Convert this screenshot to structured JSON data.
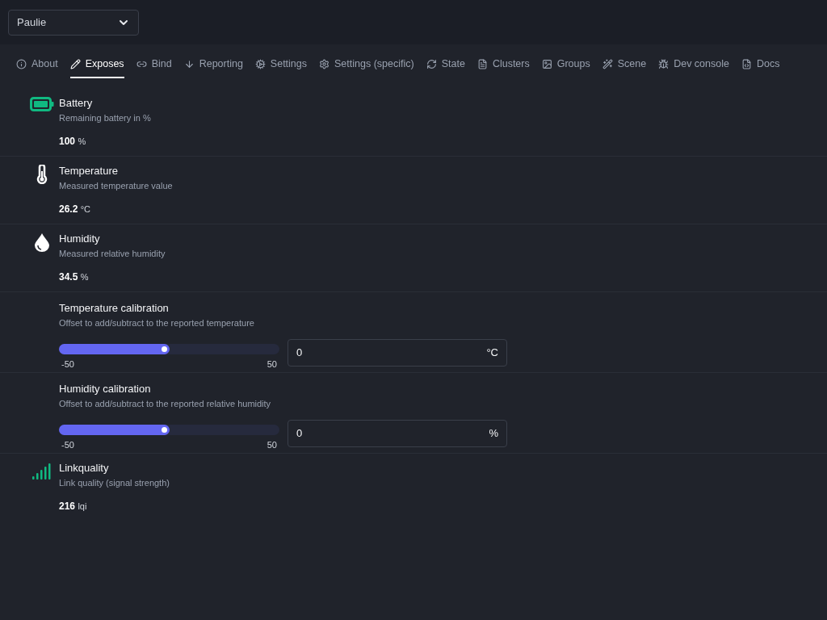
{
  "device_select": {
    "value": "Paulie"
  },
  "tabs": [
    {
      "label": "About",
      "selected": false
    },
    {
      "label": "Exposes",
      "selected": true
    },
    {
      "label": "Bind",
      "selected": false
    },
    {
      "label": "Reporting",
      "selected": false
    },
    {
      "label": "Settings",
      "selected": false
    },
    {
      "label": "Settings (specific)",
      "selected": false
    },
    {
      "label": "State",
      "selected": false
    },
    {
      "label": "Clusters",
      "selected": false
    },
    {
      "label": "Groups",
      "selected": false
    },
    {
      "label": "Scene",
      "selected": false
    },
    {
      "label": "Dev console",
      "selected": false
    },
    {
      "label": "Docs",
      "selected": false
    }
  ],
  "exposes": [
    {
      "kind": "battery",
      "title": "Battery",
      "description": "Remaining battery in %",
      "value": "100",
      "unit": "%"
    },
    {
      "kind": "temperature",
      "title": "Temperature",
      "description": "Measured temperature value",
      "value": "26.2",
      "unit": "°C"
    },
    {
      "kind": "humidity",
      "title": "Humidity",
      "description": "Measured relative humidity",
      "value": "34.5",
      "unit": "%"
    },
    {
      "kind": "calibration",
      "title": "Temperature calibration",
      "description": "Offset to add/subtract to the reported temperature",
      "level": 0.5,
      "min": "-50",
      "max": "50",
      "value": "0",
      "unit": "°C"
    },
    {
      "kind": "calibration",
      "title": "Humidity calibration",
      "description": "Offset to add/subtract to the reported relative humidity",
      "level": 0.5,
      "min": "-50",
      "max": "50",
      "value": "0",
      "unit": "%"
    },
    {
      "kind": "signal",
      "title": "Linkquality",
      "description": "Link quality (signal strength)",
      "value": "216",
      "unit": "lqi"
    }
  ]
}
